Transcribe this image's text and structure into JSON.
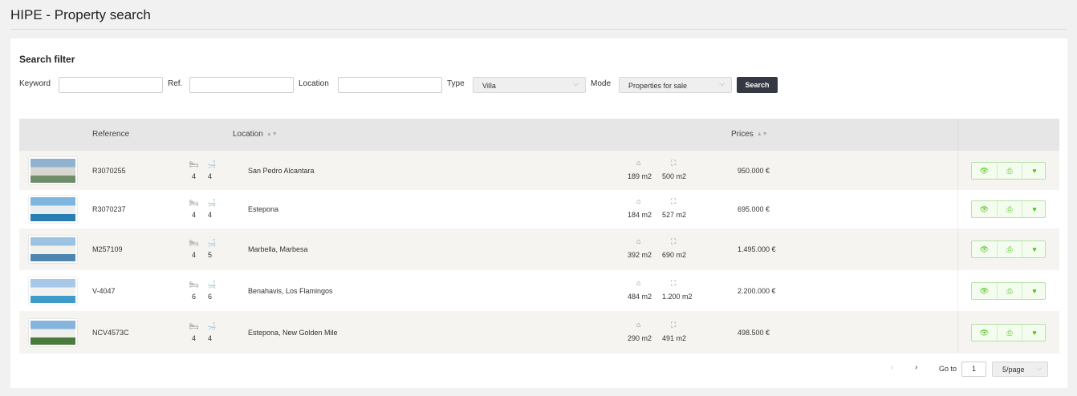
{
  "app": {
    "title": "HIPE - Property search"
  },
  "filter": {
    "title": "Search filter",
    "keyword_label": "Keyword",
    "keyword_value": "",
    "ref_label": "Ref.",
    "ref_value": "",
    "location_label": "Location",
    "location_value": "",
    "type_label": "Type",
    "type_value": "Villa",
    "mode_label": "Mode",
    "mode_value": "Properties for sale",
    "search_label": "Search"
  },
  "table": {
    "headers": {
      "reference": "Reference",
      "location": "Location",
      "prices": "Prices"
    },
    "rows": [
      {
        "reference": "R3070255",
        "beds": "4",
        "baths": "4",
        "location": "San Pedro Alcantara",
        "built": "189 m2",
        "plot": "500 m2",
        "price": "950.000 €"
      },
      {
        "reference": "R3070237",
        "beds": "4",
        "baths": "4",
        "location": "Estepona",
        "built": "184 m2",
        "plot": "527 m2",
        "price": "695.000 €"
      },
      {
        "reference": "M257109",
        "beds": "4",
        "baths": "5",
        "location": "Marbella, Marbesa",
        "built": "392 m2",
        "plot": "690 m2",
        "price": "1.495.000 €"
      },
      {
        "reference": "V-4047",
        "beds": "6",
        "baths": "6",
        "location": "Benahavis, Los Flamingos",
        "built": "484 m2",
        "plot": "1.200 m2",
        "price": "2.200.000 €"
      },
      {
        "reference": "NCV4573C",
        "beds": "4",
        "baths": "4",
        "location": "Estepona, New Golden Mile",
        "built": "290 m2",
        "plot": "491 m2",
        "price": "498.500 €"
      }
    ]
  },
  "pagination": {
    "goto_label": "Go to",
    "goto_value": "1",
    "page_size": "5/page"
  },
  "icons": {
    "bed": "bed-icon",
    "bath": "bath-icon",
    "house": "house-icon",
    "expand": "expand-icon",
    "eye": "eye-icon",
    "print": "printer-icon",
    "heart": "heart-icon"
  },
  "colors": {
    "accent_green": "#52c41a",
    "search_button": "#333842",
    "row_alt": "#f5f4f1",
    "header": "#e6e6e6"
  }
}
